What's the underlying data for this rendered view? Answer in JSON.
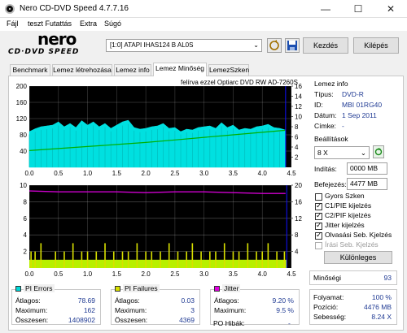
{
  "window": {
    "title": "Nero CD-DVD Speed 4.7.7.16",
    "minimize": "—",
    "maximize": "☐",
    "close": "✕"
  },
  "menu": [
    "Fájl",
    "teszt Futattás",
    "Extra",
    "Súgó"
  ],
  "toolbar": {
    "logo_top": "nero",
    "logo_bottom": "CD·DVD SPEED",
    "drive": "[1:0]   ATAPI IHAS124   B AL0S",
    "start_button": "Kezdés",
    "exit_button": "Kilépés"
  },
  "tabs": [
    "Benchmark",
    "Lemez létrehozása",
    "Lemez info",
    "Lemez Minőség",
    "LemezSzken"
  ],
  "active_tab": "Lemez Minőség",
  "chart_caption": "felírva ezzel Optiarc  DVD RW AD-7260S",
  "disc_info": {
    "heading": "Lemez info",
    "rows": [
      {
        "label": "Típus:",
        "value": "DVD-R"
      },
      {
        "label": "ID:",
        "value": "MBI 01RG40"
      },
      {
        "label": "Dátum:",
        "value": "1 Sep 2011"
      },
      {
        "label": "Címke:",
        "value": "-"
      }
    ]
  },
  "settings": {
    "heading": "Beállítások",
    "speed": "8 X",
    "start_label": "Indítás:",
    "start_value": "0000 MB",
    "end_label": "Befejezés:",
    "end_value": "4477 MB",
    "checks": [
      {
        "label": "Gyors Szken",
        "checked": false,
        "disabled": false
      },
      {
        "label": "C1/PIE kijelzés",
        "checked": true,
        "disabled": false
      },
      {
        "label": "C2/PIF kijelzés",
        "checked": true,
        "disabled": false
      },
      {
        "label": "Jitter kijelzés",
        "checked": true,
        "disabled": false
      },
      {
        "label": "Olvasási Seb. Kjelzés",
        "checked": true,
        "disabled": false
      },
      {
        "label": "Írási Seb. Kjelzés",
        "checked": false,
        "disabled": true
      }
    ],
    "advanced_button": "Különleges"
  },
  "quality": {
    "label": "Minőségi",
    "value": "93"
  },
  "progress": {
    "rows": [
      {
        "label": "Folyamat:",
        "value": "100 %"
      },
      {
        "label": "Pozíció:",
        "value": "4476 MB"
      },
      {
        "label": "Sebesség:",
        "value": "8.24 X"
      }
    ]
  },
  "stats": {
    "pi_errors": {
      "title": "PI Errors",
      "color": "#00d8d8",
      "rows": [
        {
          "label": "Átlagos:",
          "value": "78.69"
        },
        {
          "label": "Maximum:",
          "value": "162"
        },
        {
          "label": "Összesen:",
          "value": "1408902"
        }
      ]
    },
    "pi_failures": {
      "title": "PI Failures",
      "color": "#d8e000",
      "rows": [
        {
          "label": "Átlagos:",
          "value": "0.03"
        },
        {
          "label": "Maximum:",
          "value": "3"
        },
        {
          "label": "Összesen:",
          "value": "4369"
        }
      ]
    },
    "jitter": {
      "title": "Jitter",
      "color": "#e000e0",
      "rows": [
        {
          "label": "Átlagos:",
          "value": "9.20 %"
        },
        {
          "label": "Maximum:",
          "value": "9.5 %"
        }
      ],
      "po_label": "PO Hibák:",
      "po_value": "-"
    }
  },
  "colors": {
    "pie_fill": "#00e0e0",
    "read_speed": "#00b000",
    "pif_fill": "#b8f000",
    "pif_spike": "#d8e000",
    "jitter": "#d000d0",
    "plot_bg": "#000000",
    "marker": "#1010ff"
  },
  "chart_data": [
    {
      "type": "area",
      "name": "PI Errors",
      "xlim": [
        0,
        4.5
      ],
      "ylim_left": [
        0,
        200
      ],
      "ylim_right": [
        0,
        16
      ],
      "x_ticks": [
        "0.0",
        "0.5",
        "1.0",
        "1.5",
        "2.0",
        "2.5",
        "3.0",
        "3.5",
        "4.0",
        "4.5"
      ],
      "y_ticks_left": [
        "200",
        "160",
        "120",
        "80",
        "40"
      ],
      "y_ticks_right": [
        "16",
        "14",
        "12",
        "10",
        "8",
        "6",
        "4",
        "2"
      ],
      "pie_envelope": {
        "x": [
          0.0,
          0.1,
          0.2,
          0.3,
          0.4,
          0.5,
          0.6,
          0.7,
          0.8,
          0.9,
          1.0,
          1.1,
          1.2,
          1.3,
          1.4,
          1.5,
          1.6,
          1.7,
          1.8,
          1.9,
          2.0,
          2.1,
          2.2,
          2.3,
          2.4,
          2.5,
          2.6,
          2.7,
          2.8,
          2.9,
          3.0,
          3.1,
          3.2,
          3.3,
          3.4,
          3.5,
          3.6,
          3.7,
          3.8,
          3.9,
          4.0,
          4.1,
          4.2,
          4.3,
          4.4
        ],
        "y": [
          88,
          95,
          100,
          102,
          104,
          112,
          100,
          108,
          98,
          115,
          104,
          112,
          100,
          108,
          96,
          104,
          112,
          116,
          98,
          94,
          96,
          100,
          102,
          108,
          96,
          98,
          88,
          94,
          92,
          98,
          100,
          102,
          96,
          110,
          98,
          104,
          92,
          96,
          94,
          100,
          102,
          106,
          98,
          96,
          92
        ]
      },
      "read_speed": {
        "x": [
          0.0,
          0.5,
          1.0,
          1.5,
          2.0,
          2.5,
          3.0,
          3.5,
          4.0,
          4.4
        ],
        "y": [
          3.3,
          3.7,
          4.1,
          4.5,
          4.9,
          5.4,
          5.9,
          6.4,
          6.9,
          7.3
        ]
      }
    },
    {
      "type": "bar",
      "name": "PI Failures / Jitter",
      "xlim": [
        0,
        4.5
      ],
      "ylim_left": [
        0,
        10
      ],
      "ylim_right": [
        0,
        20
      ],
      "x_ticks": [
        "0.0",
        "0.5",
        "1.0",
        "1.5",
        "2.0",
        "2.5",
        "3.0",
        "3.5",
        "4.0",
        "4.5"
      ],
      "y_ticks_left": [
        "10",
        "8",
        "6",
        "4",
        "2"
      ],
      "y_ticks_right": [
        "20",
        "16",
        "12",
        "8",
        "4"
      ],
      "pif_base": 1,
      "pif_spikes": {
        "x": [
          0.03,
          0.1,
          0.2,
          0.45,
          0.6,
          0.75,
          0.9,
          1.0,
          1.15,
          1.3,
          1.45,
          1.6,
          1.7,
          1.85,
          2.0,
          2.1,
          2.25,
          2.4,
          2.55,
          2.7,
          2.8,
          2.95,
          3.1,
          3.2,
          3.35,
          3.5,
          3.6,
          3.75,
          3.9,
          4.0,
          4.1,
          4.25,
          4.38
        ],
        "y": [
          2,
          2,
          3,
          2,
          2,
          3,
          2,
          2,
          2,
          3,
          2,
          2,
          2,
          3,
          2,
          2,
          2,
          3,
          2,
          2,
          3,
          2,
          2,
          2,
          3,
          2,
          2,
          3,
          2,
          2,
          3,
          2,
          2
        ]
      },
      "jitter": {
        "x": [
          0.0,
          0.5,
          1.0,
          1.5,
          2.0,
          2.5,
          3.0,
          3.5,
          4.0,
          4.4
        ],
        "y": [
          9.3,
          9.2,
          9.2,
          9.2,
          9.1,
          9.2,
          9.2,
          9.1,
          9.0,
          9.0
        ]
      }
    }
  ]
}
